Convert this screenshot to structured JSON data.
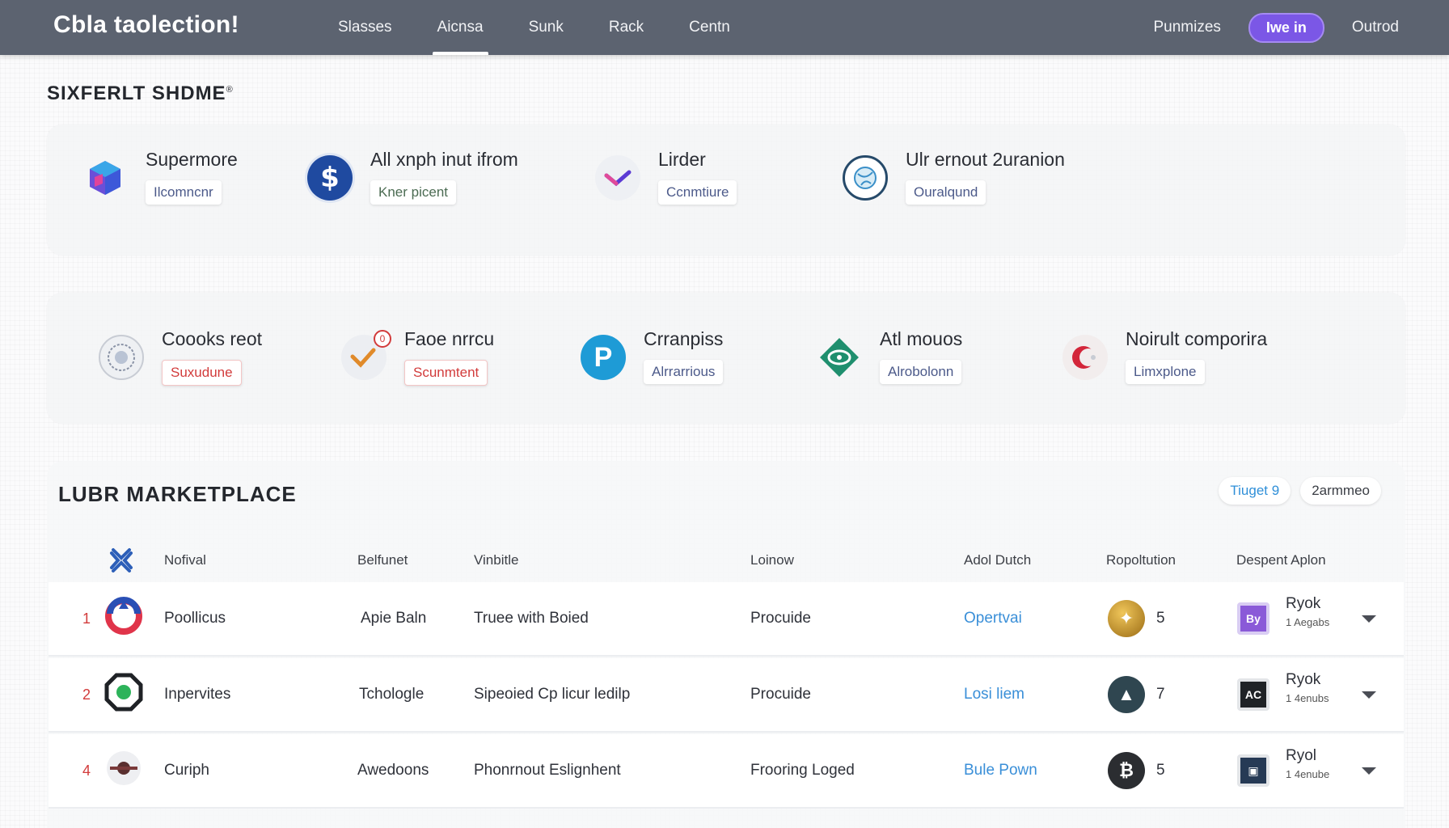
{
  "header": {
    "brand": "Cbla taolection!",
    "tabs": [
      {
        "label": "Slasses"
      },
      {
        "label": "Aicnsa"
      },
      {
        "label": "Sunk"
      },
      {
        "label": "Rack"
      },
      {
        "label": "Centn"
      }
    ],
    "active_tab": "Aicnsa",
    "right_link": "Punmizes",
    "login_button": "Iwe in",
    "outro_link": "Outrod"
  },
  "featured": {
    "title": "SIXFERLT SHDME",
    "trademark": "®",
    "row1": [
      {
        "name": "Supermore",
        "tag": "Ilcomncnr",
        "icon": "cube-icon"
      },
      {
        "name": "All xnph inut ifrom",
        "tag": "Kner picent",
        "icon": "dollar-icon"
      },
      {
        "name": "Lirder",
        "tag": "Ccnmtiure",
        "icon": "checkmark-icon"
      },
      {
        "name": "Ulr ernout 2uranion",
        "tag": "Ouralqund",
        "icon": "globe-icon"
      }
    ],
    "row2": [
      {
        "name": "Coooks reot",
        "tag": "Suxudune",
        "icon": "seal-icon"
      },
      {
        "name": "Faoe nrrcu",
        "tag": "Scunmtent",
        "icon": "check-notification-icon"
      },
      {
        "name": "Crranpiss",
        "tag": "Alrrarrious",
        "icon": "p-letter-icon"
      },
      {
        "name": "Atl mouos",
        "tag": "Alrobolonn",
        "icon": "diamond-eye-icon"
      },
      {
        "name": "Noirult comporira",
        "tag": "Limxplone",
        "icon": "crescent-icon"
      }
    ]
  },
  "marketplace": {
    "title": "LUBR MARKETPLACE",
    "chip_primary": "Tiuget 9",
    "chip_secondary": "2armmeo",
    "columns": {
      "name": "Nofival",
      "category": "Belfunet",
      "variant": "Vinbitle",
      "license": "Loinow",
      "action": "Adol Dutch",
      "reputation": "Ropoltution",
      "developer": "Despent Aplon"
    },
    "rows": [
      {
        "rank": "1",
        "name": "Poollicus",
        "category": "Apie Baln",
        "variant": "Truee with Boied",
        "license": "Procuide",
        "action": "Opertvai",
        "reputation": "5",
        "dev_badge": "By",
        "dev_name": "Ryok",
        "dev_sub": "1 Aegabs",
        "rep_color": "#c9952f"
      },
      {
        "rank": "2",
        "name": "Inpervites",
        "category": "Tchologle",
        "variant": "Sipeoied Cp licur ledilp",
        "license": "Procuide",
        "action": "Losi liem",
        "reputation": "7",
        "dev_badge": "AC",
        "dev_name": "Ryok",
        "dev_sub": "1 4enubs",
        "rep_color": "#2f4650"
      },
      {
        "rank": "4",
        "name": "Curiph",
        "category": "Awedoons",
        "variant": "Phonrnout Eslignhent",
        "license": "Frooring Loged",
        "action": "Bule Pown",
        "reputation": "5",
        "dev_badge": "▣",
        "dev_name": "Ryol",
        "dev_sub": "1 4enube",
        "rep_color": "#2b2d31"
      }
    ]
  },
  "colors": {
    "header_bg": "#5c6370",
    "accent_purple": "#7b57e6",
    "link_blue": "#3a8fd8",
    "rank_red": "#d23b3b"
  }
}
